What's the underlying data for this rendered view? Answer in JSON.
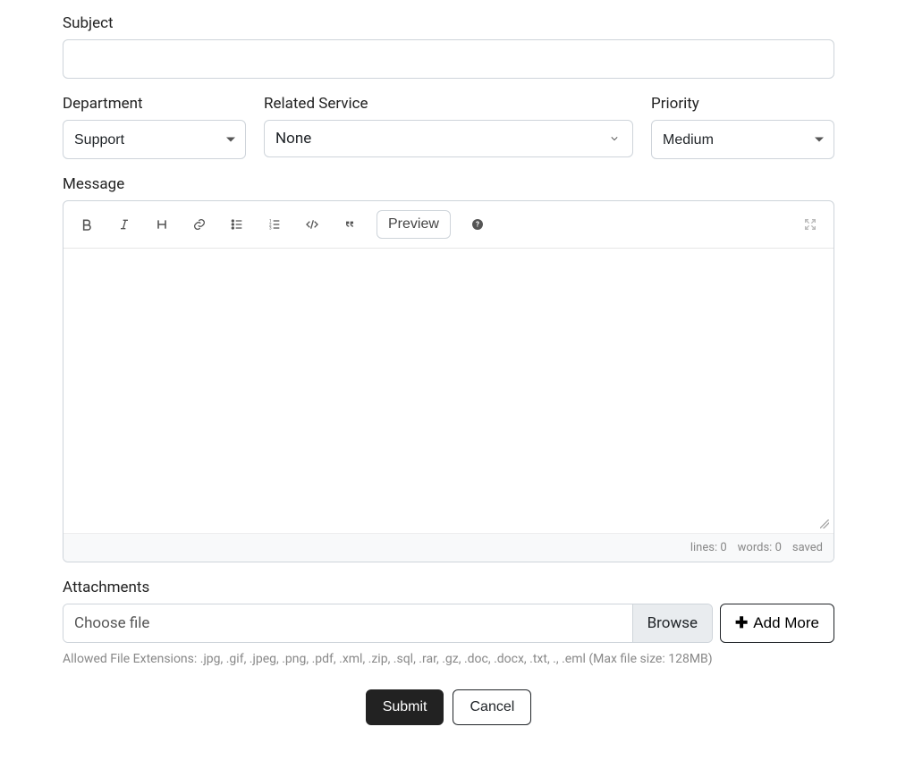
{
  "subject": {
    "label": "Subject",
    "value": ""
  },
  "department": {
    "label": "Department",
    "selected": "Support",
    "options": [
      "Support"
    ]
  },
  "related_service": {
    "label": "Related Service",
    "selected": "None"
  },
  "priority": {
    "label": "Priority",
    "selected": "Medium",
    "options": [
      "Medium"
    ]
  },
  "message": {
    "label": "Message",
    "value": "",
    "toolbar": {
      "preview": "Preview"
    },
    "status": {
      "lines_label": "lines:",
      "lines": "0",
      "words_label": "words:",
      "words": "0",
      "saved": "saved"
    }
  },
  "attachments": {
    "label": "Attachments",
    "file_placeholder": "Choose file",
    "browse": "Browse",
    "add_more": "Add More",
    "hint": "Allowed File Extensions: .jpg, .gif, .jpeg, .png, .pdf, .xml, .zip, .sql, .rar, .gz, .doc, .docx, .txt, ., .eml (Max file size: 128MB)"
  },
  "actions": {
    "submit": "Submit",
    "cancel": "Cancel"
  }
}
